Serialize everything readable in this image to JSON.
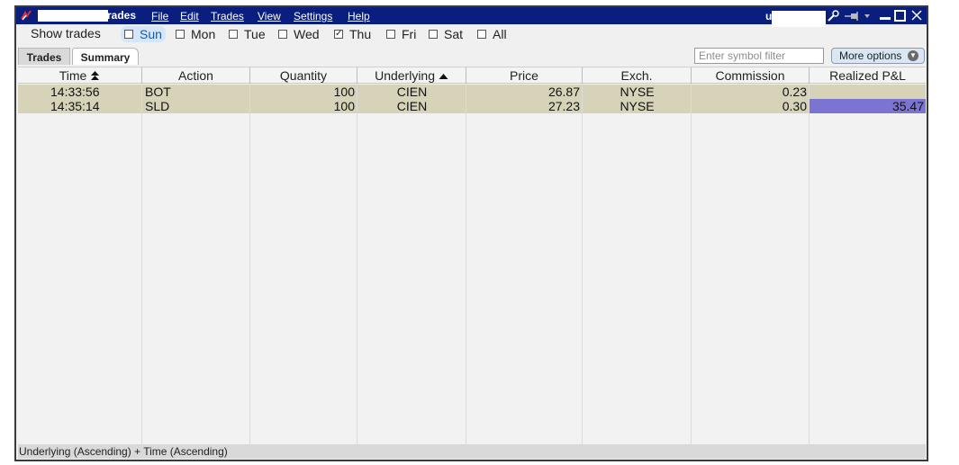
{
  "titlebar": {
    "title": "rades",
    "user_initial": "u",
    "menu": [
      "File",
      "Edit",
      "Trades",
      "View",
      "Settings",
      "Help"
    ],
    "icons": [
      "app-logo-icon",
      "wrench-icon",
      "pin-icon",
      "dropdown-icon",
      "minimize-icon",
      "maximize-icon",
      "close-icon"
    ]
  },
  "filter": {
    "label": "Show trades",
    "days": [
      {
        "label": "Sun",
        "checked": false,
        "highlighted": true
      },
      {
        "label": "Mon",
        "checked": false,
        "highlighted": false
      },
      {
        "label": "Tue",
        "checked": false,
        "highlighted": false
      },
      {
        "label": "Wed",
        "checked": false,
        "highlighted": false
      },
      {
        "label": "Thu",
        "checked": true,
        "highlighted": false
      },
      {
        "label": "Fri",
        "checked": false,
        "highlighted": false
      },
      {
        "label": "Sat",
        "checked": false,
        "highlighted": false
      },
      {
        "label": "All",
        "checked": false,
        "highlighted": false
      }
    ]
  },
  "tabs": {
    "trades": "Trades",
    "summary": "Summary",
    "active": "Summary"
  },
  "symbol_filter": {
    "placeholder": "Enter symbol filter",
    "value": ""
  },
  "more_options": {
    "label": "More options"
  },
  "table": {
    "columns": [
      "Time",
      "Action",
      "Quantity",
      "Underlying",
      "Price",
      "Exch.",
      "Commission",
      "Realized P&L"
    ],
    "sort": {
      "Time": "double-up",
      "Underlying": "up"
    },
    "rows": [
      {
        "time": "14:33:56",
        "action": "BOT",
        "quantity": "100",
        "underlying": "CIEN",
        "price": "26.87",
        "exch": "NYSE",
        "commission": "0.23",
        "pnl": ""
      },
      {
        "time": "14:35:14",
        "action": "SLD",
        "quantity": "100",
        "underlying": "CIEN",
        "price": "27.23",
        "exch": "NYSE",
        "commission": "0.30",
        "pnl": "35.47"
      }
    ]
  },
  "status": {
    "text": "Underlying (Ascending)  + Time (Ascending)"
  },
  "colors": {
    "titlebar": "#0a1e80",
    "row_bg": "#d6d3b8",
    "pnl_highlight": "#7b74d3",
    "window_bg": "#f0f0f0"
  }
}
